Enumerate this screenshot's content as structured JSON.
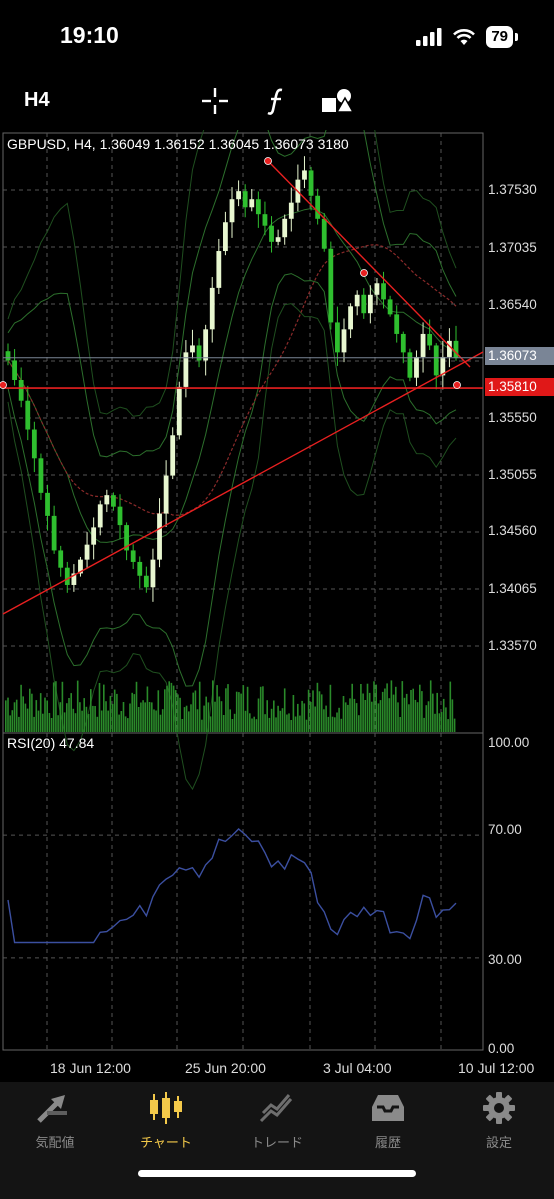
{
  "status": {
    "time": "19:10",
    "battery": "79"
  },
  "toolbar": {
    "timeframe": "H4",
    "tools": [
      "crosshair-icon",
      "indicators-icon",
      "objects-icon"
    ]
  },
  "chart": {
    "title": "GBPUSD, H4, 1.36049 1.36152 1.36045 1.36073 3180",
    "price_labels": [
      "1.37530",
      "1.37035",
      "1.36540",
      "1.35550",
      "1.35055",
      "1.34560",
      "1.34065",
      "1.33570"
    ],
    "current_price": "1.36073",
    "hline_price": "1.35810",
    "rsi_title": "RSI(20) 47.84",
    "rsi_labels": [
      "100.00",
      "70.00",
      "30.00",
      "0.00"
    ],
    "time_labels": [
      "18 Jun 12:00",
      "25 Jun 20:00",
      "3 Jul 04:00",
      "10 Jul 12:00"
    ],
    "colors": {
      "bull": "#e8f7d0",
      "bear": "#2fbf2f",
      "trendline": "#e82020",
      "rsi": "#3b4fa0",
      "volume": "#2a8a2a",
      "bands": "#2c6f2c",
      "ma": "#8a2a2a"
    }
  },
  "chart_data": {
    "type": "candlestick",
    "symbol": "GBPUSD",
    "timeframe": "H4",
    "ohlc": {
      "open": 1.36049,
      "high": 1.36152,
      "low": 1.36045,
      "close": 1.36073
    },
    "volume": 3180,
    "ylim": [
      1.333,
      1.38
    ],
    "rsi": {
      "period": 20,
      "value": 47.84,
      "levels": [
        70,
        30
      ],
      "ylim": [
        0,
        100
      ]
    },
    "closes": [
      1.3605,
      1.3588,
      1.357,
      1.3545,
      1.352,
      1.349,
      1.347,
      1.344,
      1.3425,
      1.341,
      1.342,
      1.3432,
      1.3445,
      1.346,
      1.348,
      1.3488,
      1.3478,
      1.3462,
      1.344,
      1.343,
      1.3418,
      1.3408,
      1.3432,
      1.3472,
      1.3505,
      1.354,
      1.3582,
      1.3612,
      1.3618,
      1.3605,
      1.3632,
      1.3668,
      1.37,
      1.3725,
      1.3745,
      1.3752,
      1.3738,
      1.3745,
      1.3732,
      1.3722,
      1.3708,
      1.3712,
      1.3728,
      1.3742,
      1.3762,
      1.377,
      1.3748,
      1.3728,
      1.3702,
      1.3638,
      1.3612,
      1.3632,
      1.3652,
      1.3662,
      1.3646,
      1.3662,
      1.3672,
      1.3658,
      1.3645,
      1.3628,
      1.3612,
      1.359,
      1.3608,
      1.3628,
      1.3618,
      1.3592,
      1.3608,
      1.3622,
      1.3607
    ]
  }
}
